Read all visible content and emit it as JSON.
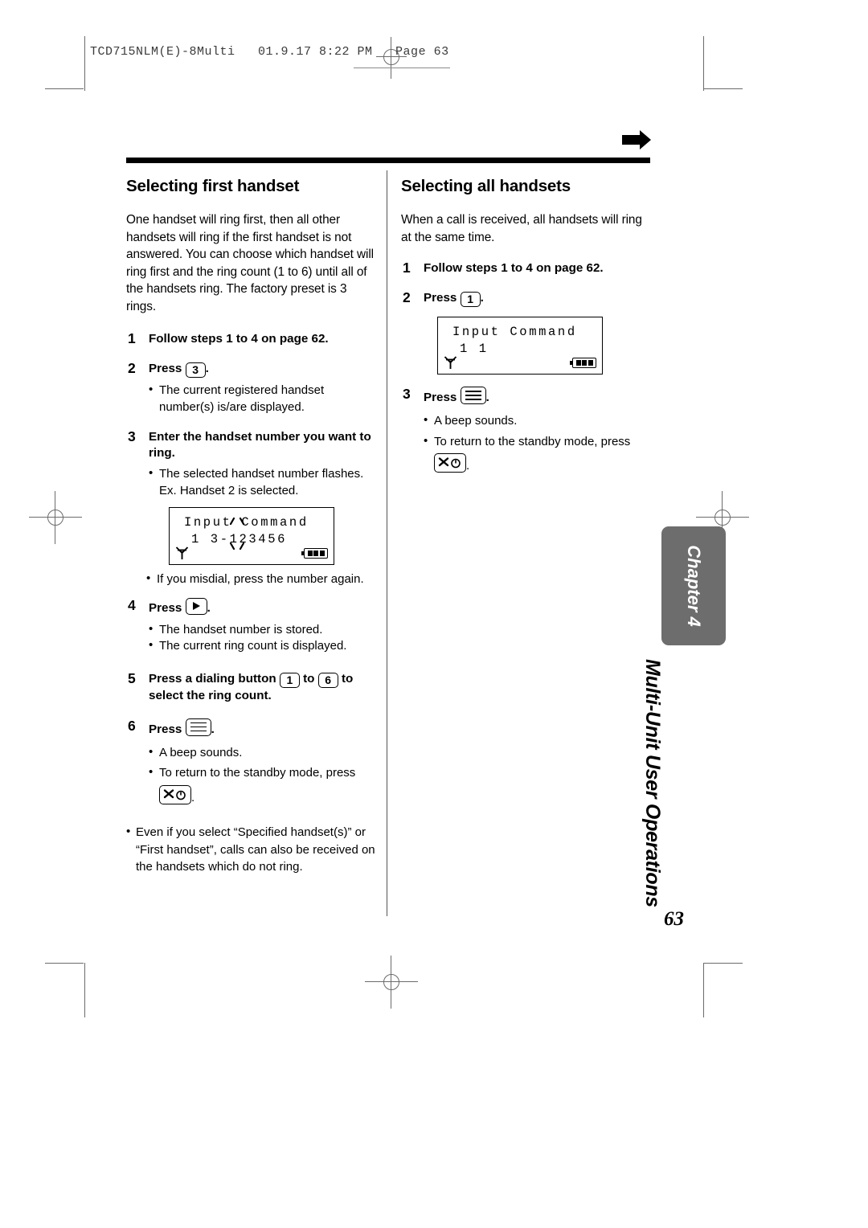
{
  "print_slug": {
    "text": "TCD715NLM(E)-8Multi   01.9.17 8:22 PM   Page 63"
  },
  "left_column": {
    "heading": "Selecting first handset",
    "intro": "One handset will ring first, then all other handsets will ring if the first handset is not answered. You can choose which handset will ring first and the ring count (1 to 6) until all of the handsets ring. The factory preset is 3 rings.",
    "steps": [
      {
        "num": "1",
        "text": "Follow steps 1 to 4 on page 62."
      },
      {
        "num": "2",
        "pre": "Press",
        "key": "3",
        "post": ".",
        "bullets": [
          "The current registered handset number(s) is/are displayed."
        ]
      },
      {
        "num": "3",
        "text": "Enter the handset number you want to ring.",
        "bullets": [
          "The selected handset number flashes. Ex. Handset 2 is selected."
        ]
      },
      {
        "num": "4",
        "pre": "Press",
        "key_icon": "play-key-icon",
        "post": ".",
        "bullets": [
          "The handset number is stored.",
          "The current ring count is displayed."
        ]
      },
      {
        "num": "5",
        "pre": "Press a dialing button",
        "key": "1",
        "mid": "to",
        "key2": "6",
        "post": "to select the ring count."
      },
      {
        "num": "6",
        "pre": "Press",
        "key_icon": "menu-key-icon",
        "post": ".",
        "bullets": [
          "A beep sounds.",
          "To return to the standby mode, press"
        ]
      }
    ],
    "lcd": {
      "line1": "Input Command",
      "line2": "1 3-123456",
      "antenna": "antenna-icon",
      "battery_bars": 3
    },
    "misdial_note": "If you misdial, press the number again.",
    "off_hook_suffix": ".",
    "final_note": "Even if you select “Specified handset(s)” or “First handset”, calls can also be received on the handsets which do not ring."
  },
  "right_column": {
    "heading": "Selecting all handsets",
    "intro": "When a call is received, all handsets will ring at the same time.",
    "steps": [
      {
        "num": "1",
        "text": "Follow steps 1 to 4 on page 62."
      },
      {
        "num": "2",
        "pre": "Press",
        "key": "1",
        "post": "."
      },
      {
        "num": "3",
        "pre": "Press",
        "key_icon": "menu-key-icon",
        "post": ".",
        "bullets": [
          "A beep sounds.",
          "To return to the standby mode, press"
        ]
      }
    ],
    "lcd": {
      "line1": "Input Command",
      "line2": "1 1",
      "antenna": "antenna-icon",
      "battery_bars": 3
    },
    "off_hook_suffix": "."
  },
  "chapter_tab": {
    "label": "Chapter 4",
    "vertical_title": "Multi-Unit User Operations",
    "tab_color": "#6d6d6d"
  },
  "page_number": "63"
}
